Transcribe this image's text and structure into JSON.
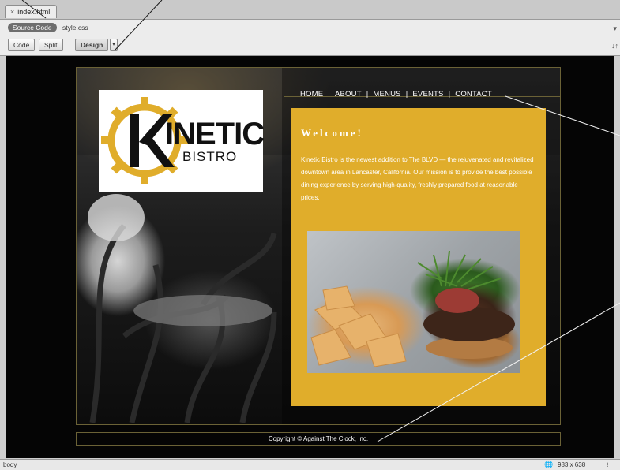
{
  "tabs": {
    "close_glyph": "×",
    "active_file": "index.html"
  },
  "related_files": {
    "source_code": "Source Code",
    "style_css": "style.css"
  },
  "view_buttons": {
    "code": "Code",
    "split": "Split",
    "design": "Design",
    "dropdown": "▾"
  },
  "toolbar_right": {
    "top_glyph": "▾",
    "bottom_glyph": "↓↑"
  },
  "page": {
    "nav": [
      "HOME",
      "ABOUT",
      "MENUS",
      "EVENTS",
      "CONTACT"
    ],
    "nav_separator": "|",
    "logo": {
      "main": "INETIC",
      "sub": "BISTRO"
    },
    "welcome": "Welcome!",
    "paragraph": "Kinetic Bistro is the newest addition to The BLVD — the rejuvenated and revitalized downtown area in Lancaster, California. Our mission is to provide the best possible dining experience by serving high-quality, freshly prepared food at reasonable prices.",
    "footer": "Copyright © Against The Clock, Inc."
  },
  "status": {
    "tag": "body",
    "globe_icon": "globe-icon",
    "size": "983 x 638",
    "menu": "⁝"
  },
  "colors": {
    "content_bg": "#e0ad2b",
    "design_bg": "#050505",
    "gear": "#e0ad2b"
  }
}
